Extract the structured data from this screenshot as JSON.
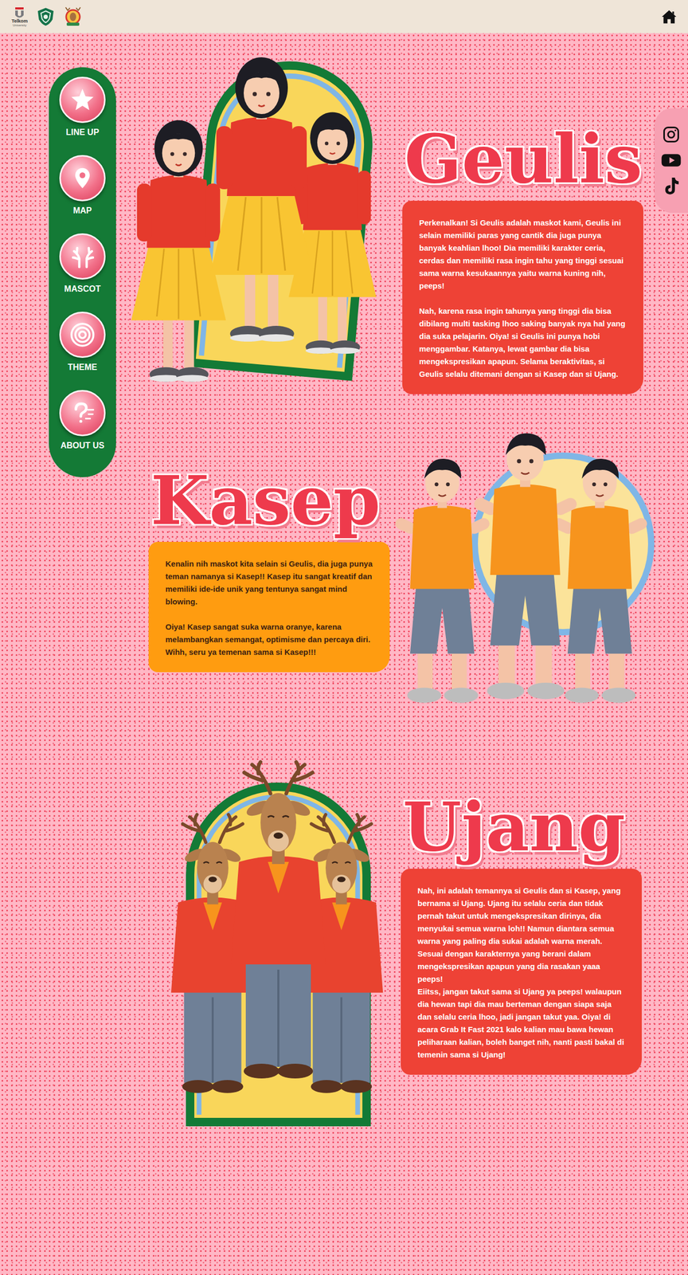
{
  "header": {
    "logo_text": [
      "Telkom",
      "University"
    ]
  },
  "sidebar": {
    "items": [
      {
        "label": "LINE UP",
        "selected": false
      },
      {
        "label": "MAP",
        "selected": false
      },
      {
        "label": "MASCOT",
        "selected": false
      },
      {
        "label": "THEME",
        "selected": false
      },
      {
        "label": "ABOUT US",
        "selected": false
      }
    ]
  },
  "mascots": [
    {
      "name": "Geulis",
      "kind": "girl",
      "color": "#ee4236",
      "paragraphs": [
        "Perkenalkan! Si Geulis adalah maskot kami, Geulis ini selain memiliki paras yang cantik dia juga punya banyak keahlian lhoo! Dia memiliki karakter ceria, cerdas dan memiliki rasa ingin tahu yang tinggi sesuai sama warna kesukaannya yaitu warna kuning nih, peeps!",
        "Nah, karena rasa ingin tahunya yang tinggi dia bisa dibilang multi tasking lhoo saking banyak nya hal yang dia suka pelajarin. Oiya! si Geulis ini punya hobi menggambar. Katanya, lewat gambar dia bisa mengekspresikan apapun. Selama beraktivitas, si Geulis selalu ditemani dengan si Kasep dan si Ujang."
      ]
    },
    {
      "name": "Kasep",
      "kind": "boy",
      "color": "#ff9c10",
      "paragraphs": [
        "Kenalin nih maskot kita selain si Geulis, dia juga punya teman namanya si Kasep!! Kasep itu sangat kreatif dan memiliki ide-ide unik yang tentunya sangat mind blowing.",
        "Oiya! Kasep sangat suka warna oranye, karena melambangkan semangat, optimisme dan percaya diri. Wihh, seru ya temenan sama si Kasep!!!"
      ]
    },
    {
      "name": "Ujang",
      "kind": "deer",
      "color": "#ee4236",
      "paragraphs": [
        "Nah, ini adalah temannya si Geulis dan si Kasep, yang bernama si Ujang. Ujang itu selalu ceria dan tidak pernah takut untuk mengekspresikan dirinya, dia menyukai semua warna loh!! Namun diantara semua warna yang paling dia sukai adalah warna merah. Sesuai dengan karakternya yang berani dalam mengekspresikan apapun yang dia rasakan yaaa peeps!\nEiitss, jangan takut sama si Ujang ya peeps! walaupun dia hewan tapi dia mau berteman dengan siapa saja dan selalu ceria lhoo, jadi jangan takut yaa. Oiya! di acara Grab It Fast 2021 kalo kalian mau bawa hewan peliharaan kalian, boleh banget nih, nanti pasti bakal di temenin sama si Ujang!"
      ]
    }
  ]
}
